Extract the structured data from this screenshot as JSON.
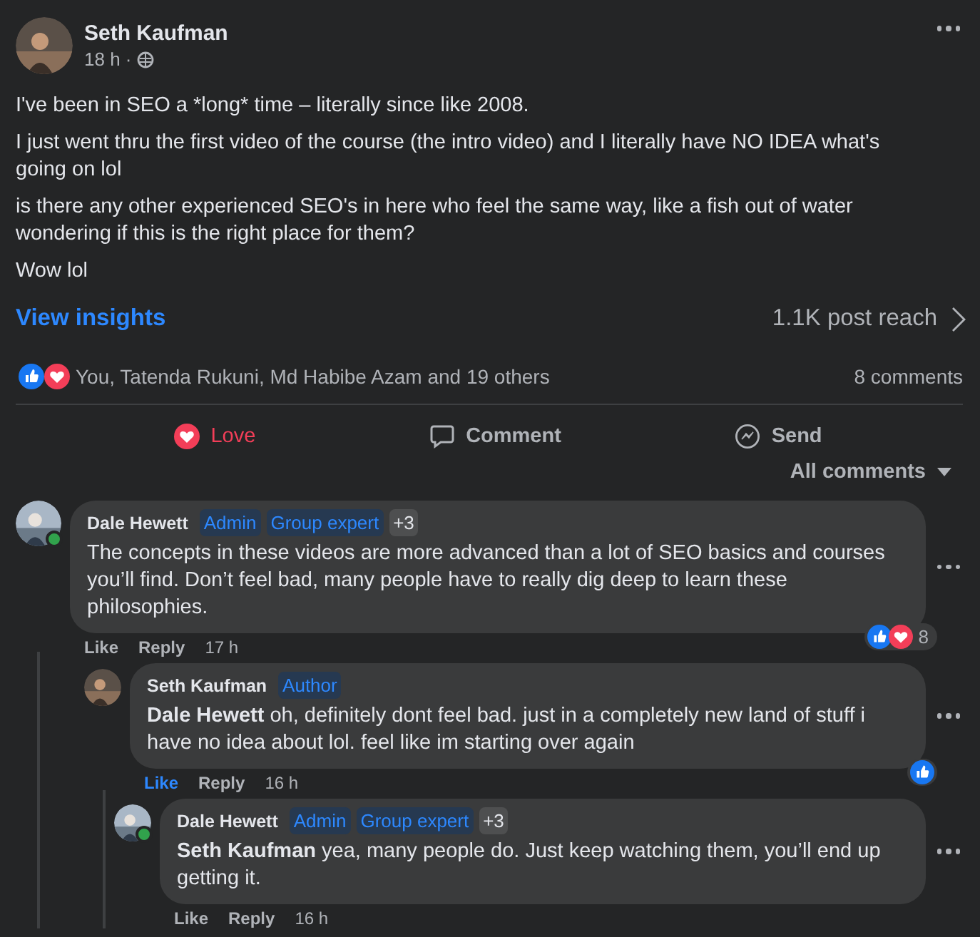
{
  "post": {
    "author": "Seth Kaufman",
    "time": "18 h ·",
    "paragraphs": [
      "I've been in SEO a *long* time – literally since like 2008.",
      "I just went thru the first video of the course (the intro video) and I literally have NO IDEA what's going on lol",
      "is there any other experienced SEO's in here who feel the same way, like a fish out of water wondering if this is the right place for them?",
      "Wow lol"
    ]
  },
  "insights": {
    "link": "View insights",
    "reach": "1.1K post reach"
  },
  "reactions": {
    "icons": [
      {
        "kind": "like"
      },
      {
        "kind": "love"
      }
    ],
    "summary": "You, Tatenda Rukuni, Md Habibe Azam and 19 others",
    "comments": "8 comments"
  },
  "actions": [
    {
      "kind": "love",
      "label": "Love",
      "selected": true
    },
    {
      "kind": "comment",
      "label": "Comment",
      "selected": false
    },
    {
      "kind": "send",
      "label": "Send",
      "selected": false
    }
  ],
  "sort": "All comments",
  "comments": [
    {
      "author": "Dale Hewett",
      "online": true,
      "badges": [
        {
          "kind": "role",
          "label": "Admin"
        },
        {
          "kind": "role",
          "label": "Group expert"
        },
        {
          "kind": "more",
          "label": "+3"
        }
      ],
      "text": "The concepts in these videos are more advanced than a lot of SEO basics and courses you’ll find. Don’t feel bad, many people have to really dig deep to learn these philosophies.",
      "like": "Like",
      "liked": false,
      "reply": "Reply",
      "time": "17 h",
      "reaction_icons": [
        {
          "kind": "like"
        },
        {
          "kind": "love"
        }
      ],
      "reaction_count": "8",
      "children": [
        {
          "author": "Seth Kaufman",
          "online": false,
          "badges": [
            {
              "kind": "role",
              "label": "Author"
            }
          ],
          "text": "**Dale Hewett** oh, definitely dont feel bad. just in a completely new land of stuff i have no idea about lol. feel like im starting over again",
          "like": "Like",
          "liked": true,
          "reply": "Reply",
          "time": "16 h",
          "reaction_icons": [
            {
              "kind": "like"
            }
          ],
          "children": [
            {
              "author": "Dale Hewett",
              "online": true,
              "badges": [
                {
                  "kind": "role",
                  "label": "Admin"
                },
                {
                  "kind": "role",
                  "label": "Group expert"
                },
                {
                  "kind": "more",
                  "label": "+3"
                }
              ],
              "text": "**Seth Kaufman** yea, many people do. Just keep watching them, you’ll end up getting it.",
              "like": "Like",
              "liked": false,
              "reply": "Reply",
              "time": "16 h"
            }
          ]
        }
      ]
    }
  ]
}
